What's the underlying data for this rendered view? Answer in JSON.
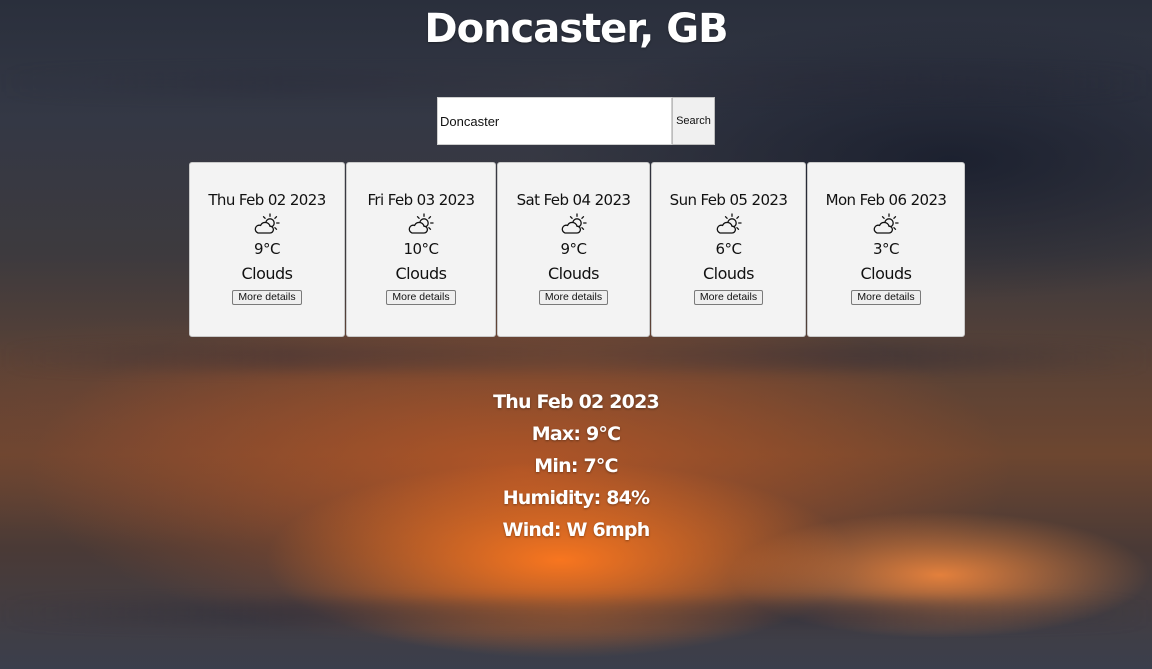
{
  "header": {
    "title": "Doncaster, GB"
  },
  "search": {
    "value": "Doncaster",
    "button_label": "Search"
  },
  "forecast": [
    {
      "date": "Thu Feb 02 2023",
      "icon": "partly-cloudy-icon",
      "temp": "9°C",
      "desc": "Clouds",
      "button_label": "More details"
    },
    {
      "date": "Fri Feb 03 2023",
      "icon": "partly-cloudy-icon",
      "temp": "10°C",
      "desc": "Clouds",
      "button_label": "More details"
    },
    {
      "date": "Sat Feb 04 2023",
      "icon": "partly-cloudy-icon",
      "temp": "9°C",
      "desc": "Clouds",
      "button_label": "More details"
    },
    {
      "date": "Sun Feb 05 2023",
      "icon": "partly-cloudy-icon",
      "temp": "6°C",
      "desc": "Clouds",
      "button_label": "More details"
    },
    {
      "date": "Mon Feb 06 2023",
      "icon": "partly-cloudy-icon",
      "temp": "3°C",
      "desc": "Clouds",
      "button_label": "More details"
    }
  ],
  "details": {
    "date": "Thu Feb 02 2023",
    "max": "Max: 9°C",
    "min": "Min: 7°C",
    "humidity": "Humidity: 84%",
    "wind": "Wind: W 6mph"
  },
  "colors": {
    "card_background": "#f3f3f3",
    "text_light": "#ffffff"
  }
}
